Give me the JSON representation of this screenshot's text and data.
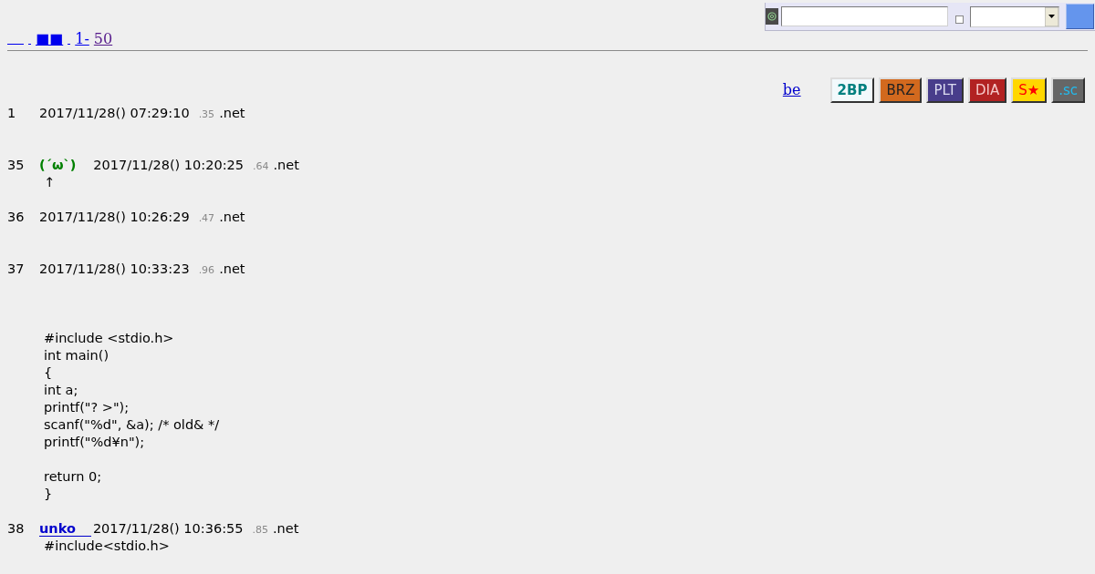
{
  "nav": {
    "links": [
      {
        "kind": "blank",
        "visited": false
      },
      {
        "kind": "space",
        "visited": false
      },
      {
        "kind": "text",
        "text": "■■",
        "visited": false
      },
      {
        "kind": "space",
        "visited": false
      },
      {
        "kind": "text",
        "text": "1-",
        "visited": false
      },
      {
        "kind": "text",
        "text": "50",
        "visited": true
      }
    ]
  },
  "search": {
    "checkbox": {
      "checked": false
    }
  },
  "board_link": "be",
  "board_buttons": [
    {
      "color": "#f2f9fc",
      "label": {
        "text": "2BP",
        "color": "#008080",
        "bold": true
      }
    },
    {
      "color": "#d2691e",
      "label": {
        "text": "BRZ",
        "color": "#222222",
        "bold": false
      }
    },
    {
      "color": "#483d8b",
      "label": {
        "text": "PLT",
        "color": "#dcdcf0",
        "bold": false
      }
    },
    {
      "color": "#b22222",
      "label": {
        "text": "DIA",
        "color": "#f5c8c8",
        "bold": false
      }
    },
    {
      "color": "#ffd700",
      "label": {
        "text": "S★",
        "color": "#ff0000",
        "bold": false
      }
    },
    {
      "color": "#666666",
      "label": {
        "text": ".sc",
        "color": "#22bbee",
        "bold": false
      }
    }
  ],
  "posts": [
    {
      "number": "1",
      "date": "2017/11/28() 07:29:10",
      "id": ".35",
      "host": ".net"
    },
    {
      "number": "35",
      "name": {
        "kind": "plain",
        "text": "(´ω`)"
      },
      "date": "2017/11/28() 10:20:25",
      "id": ".64",
      "host": ".net",
      "body": "↑"
    },
    {
      "number": "36",
      "date": "2017/11/28() 10:26:29",
      "id": ".47",
      "host": ".net"
    },
    {
      "number": "37",
      "date": "2017/11/28() 10:33:23",
      "id": ".96",
      "host": ".net",
      "body": "#include <stdio.h>\nint main()\n{\nint a;\nprintf(\"? >\");\nscanf(\"%d\", &a); /* old& */\nprintf(\"%d¥n\");\n\nreturn 0;\n}"
    },
    {
      "number": "38",
      "name": {
        "kind": "link",
        "text": "unko"
      },
      "date": "2017/11/28() 10:36:55",
      "id": ".85",
      "host": ".net",
      "body": "#include<stdio.h>"
    }
  ]
}
